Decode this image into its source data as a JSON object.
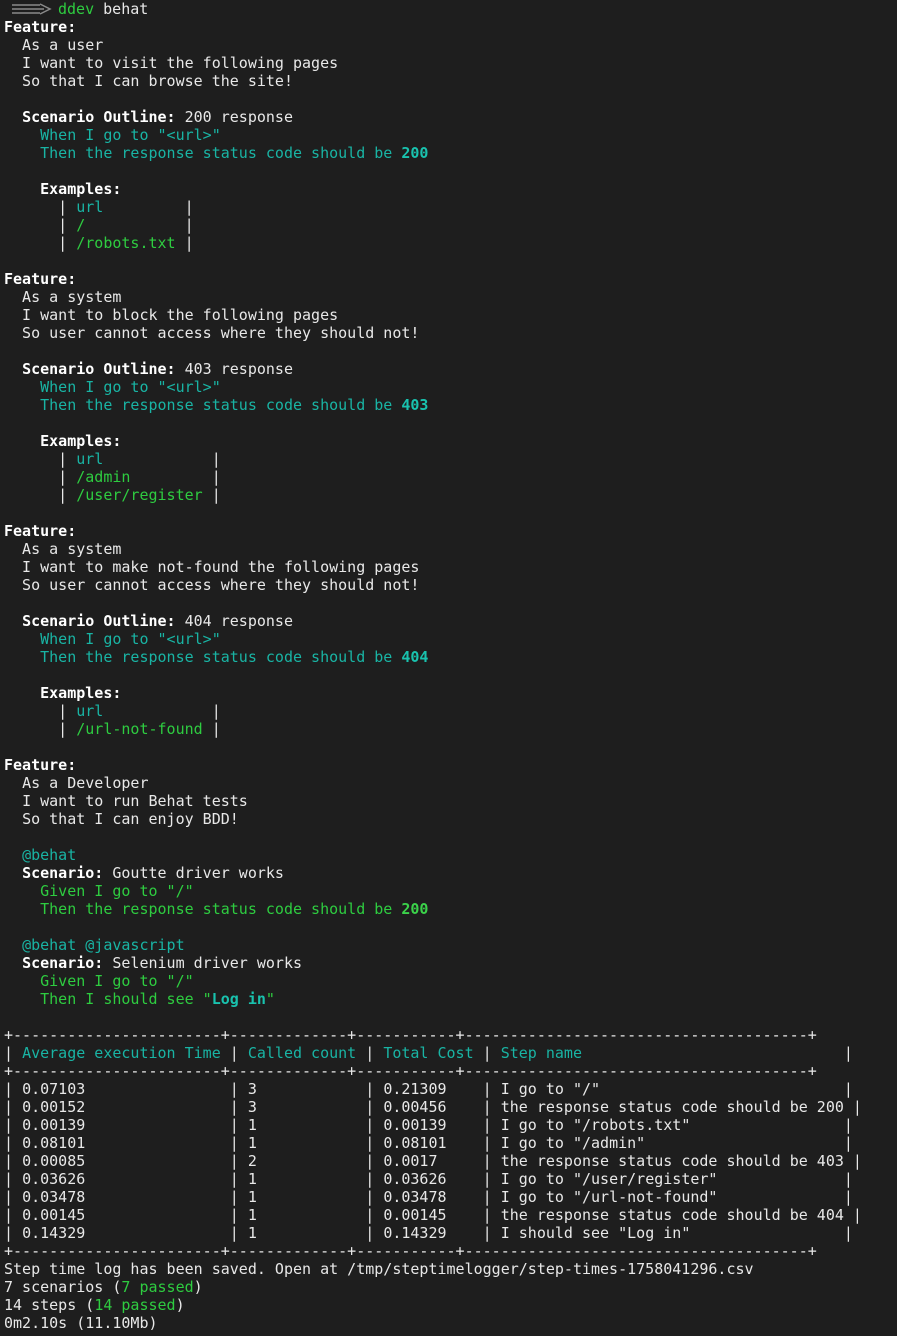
{
  "prompt": {
    "command": "ddev",
    "args": " behat"
  },
  "features": [
    {
      "label": "Feature:",
      "lines": [
        "As a user",
        "I want to visit the following pages",
        "So that I can browse the site!"
      ],
      "scenario_kw": "Scenario Outline:",
      "scenario_title": " 200 response",
      "when": "When I go to \"<url>\"",
      "then_prefix": "Then the response status code should be ",
      "then_code": "200",
      "examples_kw": "Examples:",
      "rows": [
        "url        ",
        "/          ",
        "/robots.txt"
      ]
    },
    {
      "label": "Feature:",
      "lines": [
        "As a system",
        "I want to block the following pages",
        "So user cannot access where they should not!"
      ],
      "scenario_kw": "Scenario Outline:",
      "scenario_title": " 403 response",
      "when": "When I go to \"<url>\"",
      "then_prefix": "Then the response status code should be ",
      "then_code": "403",
      "examples_kw": "Examples:",
      "rows": [
        "url           ",
        "/admin        ",
        "/user/register"
      ]
    },
    {
      "label": "Feature:",
      "lines": [
        "As a system",
        "I want to make not-found the following pages",
        "So user cannot access where they should not!"
      ],
      "scenario_kw": "Scenario Outline:",
      "scenario_title": " 404 response",
      "when": "When I go to \"<url>\"",
      "then_prefix": "Then the response status code should be ",
      "then_code": "404",
      "examples_kw": "Examples:",
      "rows": [
        "url           ",
        "/url-not-found"
      ]
    }
  ],
  "feature4": {
    "label": "Feature:",
    "lines": [
      "As a Developer",
      "I want to run Behat tests",
      "So that I can enjoy BDD!"
    ],
    "s1_tag": "@behat",
    "s1_kw": "Scenario:",
    "s1_title": " Goutte driver works",
    "s1_given": "Given I go to \"/\"",
    "s1_then_prefix": "Then the response status code should be ",
    "s1_then_code": "200",
    "s2_tag": "@behat @javascript",
    "s2_kw": "Scenario:",
    "s2_title": " Selenium driver works",
    "s2_given": "Given I go to \"/\"",
    "s2_then_prefix": "Then I should see \"",
    "s2_then_bold": "Log in",
    "s2_then_suffix": "\""
  },
  "timing_table": {
    "border": "+-----------------------+-------------+-----------+--------------------------------------+",
    "headers": [
      "Average execution Time",
      "Called count",
      "Total Cost",
      "Step name"
    ],
    "widths": [
      22,
      12,
      10,
      37
    ],
    "rows": [
      [
        "0.07103",
        "3",
        "0.21309",
        "I go to \"/\""
      ],
      [
        "0.00152",
        "3",
        "0.00456",
        "the response status code should be 200"
      ],
      [
        "0.00139",
        "1",
        "0.00139",
        "I go to \"/robots.txt\""
      ],
      [
        "0.08101",
        "1",
        "0.08101",
        "I go to \"/admin\""
      ],
      [
        "0.00085",
        "2",
        "0.0017",
        "the response status code should be 403"
      ],
      [
        "0.03626",
        "1",
        "0.03626",
        "I go to \"/user/register\""
      ],
      [
        "0.03478",
        "1",
        "0.03478",
        "I go to \"/url-not-found\""
      ],
      [
        "0.00145",
        "1",
        "0.00145",
        "the response status code should be 404"
      ],
      [
        "0.14329",
        "1",
        "0.14329",
        "I should see \"Log in\""
      ]
    ]
  },
  "summary": {
    "log_saved": "Step time log has been saved. Open at /tmp/steptimelogger/step-times-1758041296.csv",
    "scenarios_prefix": "7 scenarios (",
    "scenarios_passed": "7 passed",
    "scenarios_suffix": ")",
    "steps_prefix": "14 steps (",
    "steps_passed": "14 passed",
    "steps_suffix": ")",
    "time": "0m2.10s (11.10Mb)"
  },
  "colors": {
    "green": "#2ecc40",
    "teal": "#19b4a4",
    "background": "#1e1e1e"
  }
}
